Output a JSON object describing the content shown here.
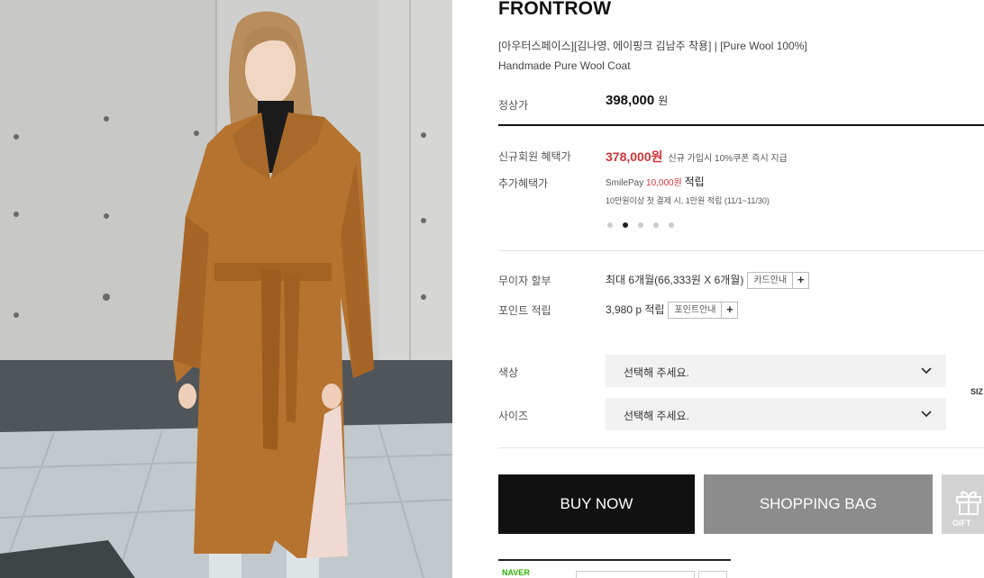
{
  "product": {
    "brand": "FRONTROW",
    "name_line1": "[아우터스페이스][김나영, 에이핑크 김남주 착용] | [Pure Wool 100%]",
    "name_line2": "Handmade Pure Wool Coat",
    "image_alt": "Camel wool coat with belt, worn by model"
  },
  "pricing": {
    "regular_label": "정상가",
    "regular_price": "398,000",
    "regular_unit": "원",
    "member_label": "신규회원 혜택가",
    "member_price": "378,000원",
    "member_note": "신규 가입시 10%쿠폰 즉시 지급",
    "extra_label": "추가혜택가",
    "smilepay_text": "SmilePay",
    "smilepay_amount": "10,000원",
    "smilepay_suffix": "적립",
    "extra_note": "10만원이상 첫 결제 시, 1만원 적립 (11/1~11/30)",
    "carousel_active_index": 1
  },
  "installment": {
    "label": "무이자 할부",
    "value": "최대 6개월(66,333원 X 6개월)",
    "button": "카드안내",
    "plus": "+"
  },
  "points": {
    "label": "포인트 적립",
    "value": "3,980 p 적립",
    "button": "포인트안내",
    "plus": "+"
  },
  "options": {
    "color_label": "색상",
    "color_placeholder": "선택해 주세요.",
    "size_label": "사이즈",
    "size_placeholder": "선택해 주세요.",
    "size_guide": "SIZ"
  },
  "actions": {
    "buy_now": "BUY NOW",
    "shopping_bag": "SHOPPING BAG",
    "gift": "GIFT"
  },
  "footer": {
    "naver_label": "NAVER"
  },
  "colors": {
    "accent_red": "#d0353a",
    "buy_bg": "#111111",
    "bag_bg": "#8c8c8c",
    "naver_green": "#2db400"
  }
}
